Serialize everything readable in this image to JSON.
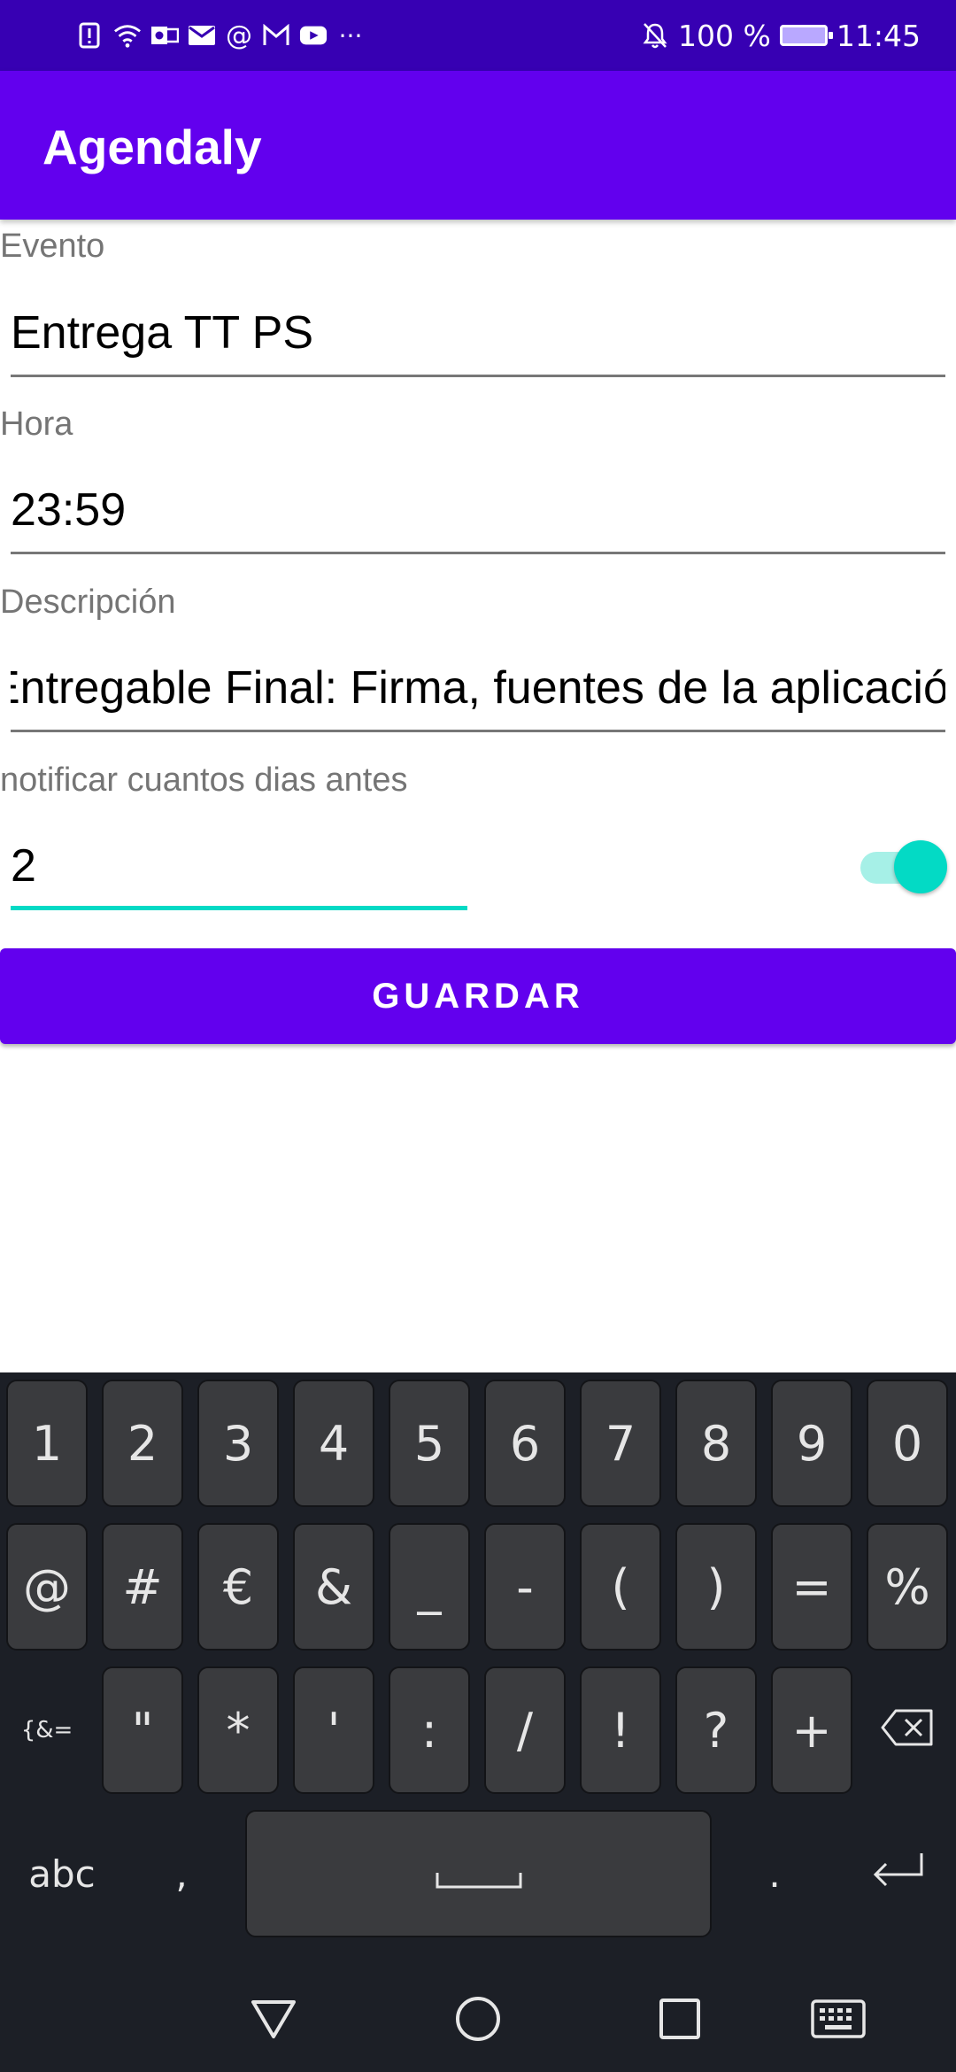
{
  "status_bar": {
    "battery": "100 %",
    "time": "11:45",
    "more": "···"
  },
  "app_bar": {
    "title": "Agendaly"
  },
  "form": {
    "event": {
      "label": "Evento",
      "value": "Entrega TT PS"
    },
    "time": {
      "label": "Hora",
      "value": "23:59"
    },
    "description": {
      "label": "Descripción",
      "value": "Entregable Final: Firma, fuentes de la aplicació"
    },
    "notify": {
      "label": "notificar cuantos dias antes",
      "value": "2",
      "toggle_on": true
    }
  },
  "save_button": {
    "label": "GUARDAR"
  },
  "keyboard": {
    "row1": [
      "1",
      "2",
      "3",
      "4",
      "5",
      "6",
      "7",
      "8",
      "9",
      "0"
    ],
    "row2": [
      "@",
      "#",
      "€",
      "&",
      "_",
      "-",
      "(",
      ")",
      "=",
      "%"
    ],
    "row3": [
      "{&=",
      "\"",
      "*",
      "'",
      ":",
      "/",
      "!",
      "?",
      "+"
    ],
    "row4": {
      "abc": "abc",
      "comma": ",",
      "period": "."
    }
  },
  "colors": {
    "primary": "#6200ee",
    "primary_dark": "#3700b3",
    "accent": "#03dac5",
    "keyboard_bg": "#1c1f26"
  }
}
